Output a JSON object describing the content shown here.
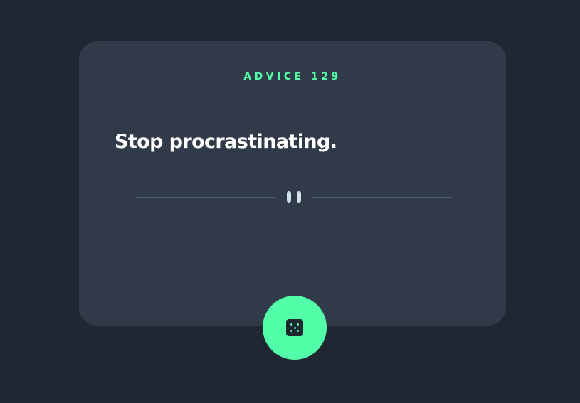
{
  "card": {
    "advice_label": "ADVICE 129",
    "quote": "Stop procrastinating."
  },
  "divider": {
    "icon": "pause-icon"
  },
  "generate_button": {
    "icon": "dice-icon"
  },
  "colors": {
    "background": "#202632",
    "card": "#313a48",
    "accent": "#52ffa8",
    "text": "#ffffff",
    "divider_line": "#4f5d74",
    "divider_icon": "#cee3e9"
  }
}
